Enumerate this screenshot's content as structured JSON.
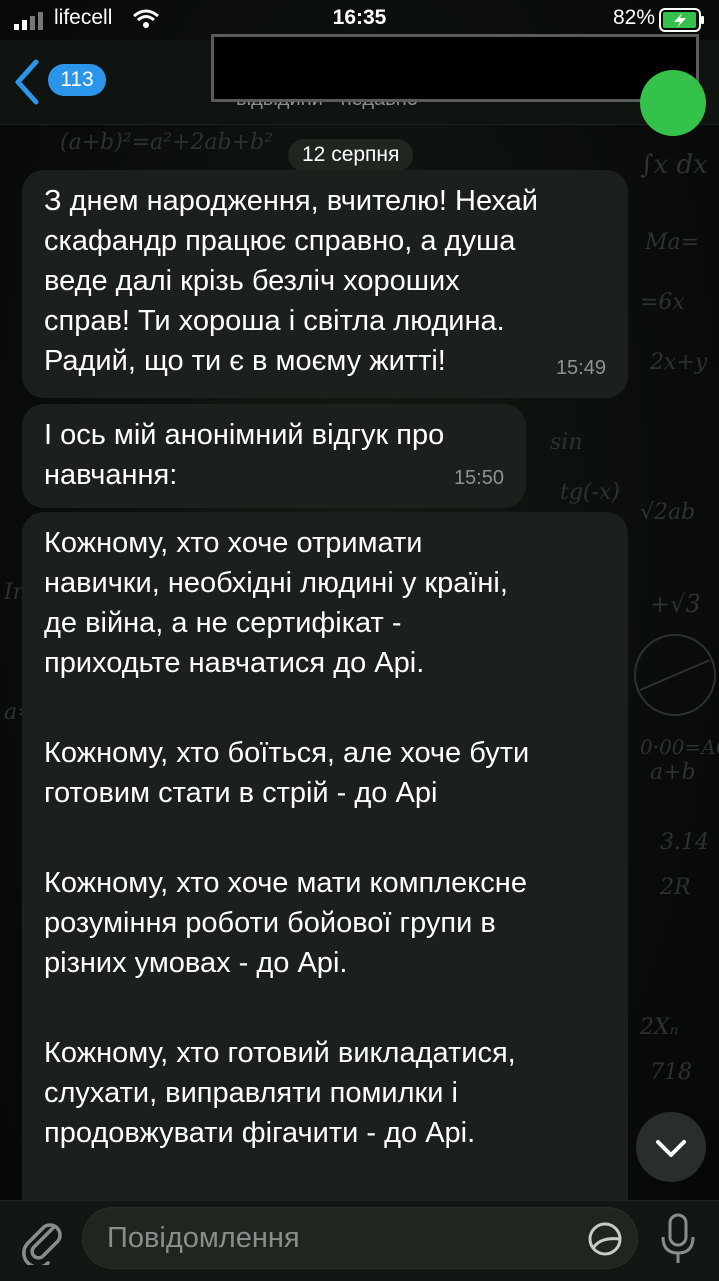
{
  "status_bar": {
    "carrier": "lifecell",
    "time": "16:35",
    "battery_percent": "82%"
  },
  "header": {
    "back_badge": "113",
    "chat_status": "відвідини · недавно"
  },
  "date_separator": "12 серпня",
  "messages": [
    {
      "lines": [
        "З днем народження, вчителю! Нехай",
        "скафандр працює справно, а душа",
        "веде далі крізь безліч хороших",
        "справ! Ти хороша і світла людина.",
        "Радий, що ти є в моєму житті!"
      ],
      "time": "15:49"
    },
    {
      "lines": [
        "І ось мій анонімний відгук про",
        "навчання:"
      ],
      "time": "15:50"
    },
    {
      "paragraphs": [
        [
          "Кожному, хто хоче отримати",
          "навички, необхідні людині у країні,",
          "де війна, а не сертифікат -",
          "приходьте навчатися до Арі."
        ],
        [
          "Кожному, хто боїться, але хоче бути",
          "готовим стати в стрій - до Арі"
        ],
        [
          "Кожному, хто хоче мати комплексне",
          "розуміння роботи бойової групи в",
          "різних умовах - до Арі."
        ],
        [
          "Кожному, хто готовий викладатися,",
          "слухати, виправляти помилки і",
          "продовжувати фігачити - до Арі."
        ]
      ]
    }
  ],
  "input": {
    "placeholder": "Повідомлення"
  },
  "colors": {
    "accent": "#2b95ea",
    "bubble": "#1c201c",
    "avatar": "#35c24a"
  }
}
